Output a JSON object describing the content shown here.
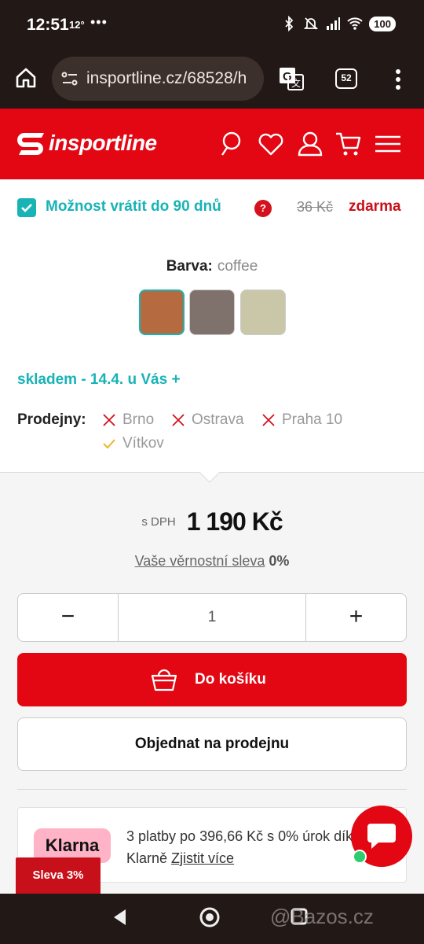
{
  "status_bar": {
    "time": "12:51",
    "temperature": "12°",
    "dots": "•••",
    "battery": "100"
  },
  "browser": {
    "url": "insportline.cz/68528/h",
    "tab_count": "52"
  },
  "header": {
    "logo_text": "insportline",
    "brand_color": "#e30613",
    "icons": [
      "search-icon",
      "heart-icon",
      "user-icon",
      "cart-icon",
      "hamburger-menu-icon"
    ]
  },
  "return_option": {
    "checked": true,
    "label": "Možnost vrátit do 90 dnů",
    "help": "?",
    "old_price": "36 Kč",
    "new_price": "zdarma"
  },
  "color": {
    "label": "Barva:",
    "selected_value": "coffee",
    "swatches": [
      {
        "name": "coffee",
        "hex": "#b66a40",
        "selected": true
      },
      {
        "name": "grey-brown",
        "hex": "#7f716b",
        "selected": false
      },
      {
        "name": "beige",
        "hex": "#c9c7a7",
        "selected": false
      }
    ]
  },
  "stock": {
    "text": "skladem - 14.4. u Vás +"
  },
  "stores": {
    "label": "Prodejny:",
    "items": [
      {
        "name": "Brno",
        "available": false
      },
      {
        "name": "Ostrava",
        "available": false
      },
      {
        "name": "Praha 10",
        "available": false
      },
      {
        "name": "Vítkov",
        "available": true
      }
    ]
  },
  "pricing": {
    "vat_label": "s DPH",
    "price": "1 190 Kč",
    "loyalty_label": "Vaše věrnostní sleva",
    "loyalty_value": "0%"
  },
  "quantity": {
    "minus": "−",
    "value": "1",
    "plus": "+"
  },
  "actions": {
    "add_to_cart": "Do košíku",
    "order_in_store": "Objednat na prodejnu"
  },
  "klarna": {
    "logo": "Klarna",
    "text": "3 platby po 396,66 Kč s 0% úrok díky Klarně",
    "link": "Zjistit více"
  },
  "discount_badge": "Sleva 3%",
  "watermark": "@Bazos.cz"
}
